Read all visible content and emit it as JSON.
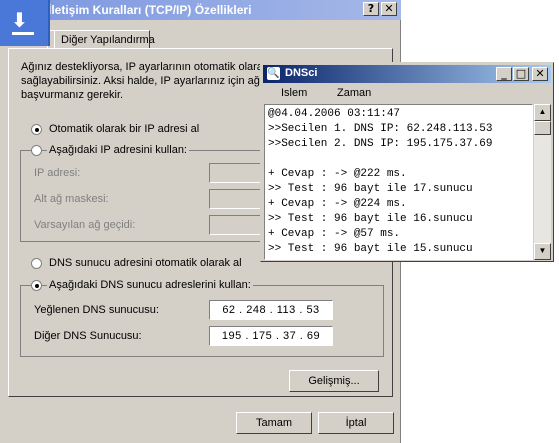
{
  "dialog": {
    "title": "İletişim Kuralları (TCP/IP) Özellikleri",
    "help_btn": "?",
    "close_btn": "✕",
    "tabs": [
      "",
      "Diğer Yapılandırma"
    ],
    "intro": [
      "Ağınız destekliyorsa, IP ayarlarının otomatik olarak a",
      "sağlayabilirsiniz. Aksi halde, IP ayarlarınız için ağ yö",
      "başvurmanız gerekir."
    ],
    "ip_auto_label": "Otomatik olarak bir IP adresi al",
    "ip_manual_label": "Aşağıdaki IP adresini kullan:",
    "ip_address_label": "IP adresi:",
    "subnet_label": "Alt ağ maskesi:",
    "gateway_label": "Varsayılan ağ geçidi:",
    "ip_placeholder": ".       .       .",
    "dns_auto_label": "DNS sunucu adresini otomatik olarak al",
    "dns_manual_label": "Aşağıdaki DNS sunucu adreslerini kullan:",
    "preferred_dns_label": "Yeğlenen DNS sunucusu:",
    "alternate_dns_label": "Diğer DNS Sunucusu:",
    "preferred_dns_value": "62  .  248  .  113  .  53",
    "alternate_dns_value": "195  .  175  .  37  .  69",
    "advanced_btn": "Gelişmiş...",
    "ok_btn": "Tamam",
    "cancel_btn": "İptal"
  },
  "dnsci": {
    "title": "DNSci",
    "min_btn": "_",
    "max_btn": "□",
    "close_btn": "✕",
    "menu": [
      "Islem",
      "Zaman"
    ],
    "lines": [
      "@04.04.2006 03:11:47",
      ">>Secilen 1. DNS IP: 62.248.113.53",
      ">>Secilen 2. DNS IP: 195.175.37.69",
      "",
      "+ Cevap : -> @222 ms.",
      ">> Test : 96 bayt ile 17.sunucu",
      "+ Cevap : -> @224 ms.",
      ">> Test : 96 bayt ile 16.sunucu",
      "+ Cevap : -> @57 ms.",
      ">> Test : 96 bayt ile 15.sunucu"
    ]
  }
}
